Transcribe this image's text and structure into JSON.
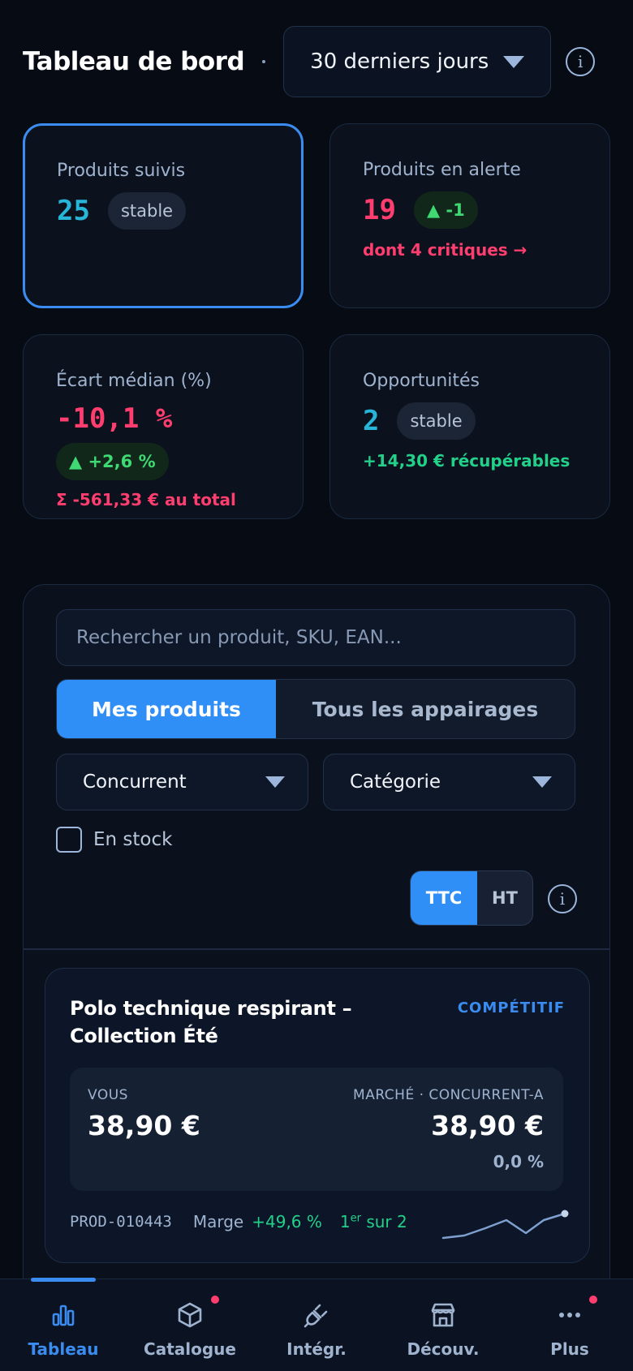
{
  "header": {
    "title": "Tableau de bord",
    "period": "30 derniers jours",
    "info_icon": "i"
  },
  "kpis": [
    {
      "label": "Produits suivis",
      "value": "25",
      "trend": "stable",
      "sub": ""
    },
    {
      "label": "Produits en alerte",
      "value": "19",
      "trend": "▲ -1",
      "sub": "dont 4 critiques →"
    },
    {
      "label": "Écart médian (%)",
      "value": "-10,1 %",
      "trend": "▲ +2,6 %",
      "sub": "Σ -561,33 € au total"
    },
    {
      "label": "Opportunités",
      "value": "2",
      "trend": "stable",
      "sub": "+14,30 € récupérables"
    }
  ],
  "filters": {
    "search_placeholder": "Rechercher un produit, SKU, EAN...",
    "tabs": [
      "Mes produits",
      "Tous les appairages"
    ],
    "competitor_select": "Concurrent",
    "category_select": "Catégorie",
    "in_stock_label": "En stock",
    "tax_toggle": [
      "TTC",
      "HT"
    ]
  },
  "product": {
    "name": "Polo technique respirant – Collection Été",
    "status": "COMPÉTITIF",
    "you_label": "VOUS",
    "your_price": "38,90 €",
    "market_label": "MARCHÉ · CONCURRENT-A",
    "market_price": "38,90 €",
    "diff": "0,0 %",
    "sku": "PROD-010443",
    "margin_label": "Marge",
    "margin_value": "+49,6 %",
    "rank_num": "1",
    "rank_sup": "er",
    "rank_rest": " sur 2"
  },
  "nav": [
    {
      "label": "Tableau",
      "icon": "bar-chart-icon",
      "active": true
    },
    {
      "label": "Catalogue",
      "icon": "box-icon",
      "badge": true
    },
    {
      "label": "Intégr.",
      "icon": "plug-icon"
    },
    {
      "label": "Découv.",
      "icon": "store-icon"
    },
    {
      "label": "Plus",
      "icon": "more-icon",
      "badge": true
    }
  ],
  "colors": {
    "accent": "#3b8cf0",
    "alert": "#ff3d6e",
    "positive": "#22d08a",
    "background": "#060b14"
  }
}
